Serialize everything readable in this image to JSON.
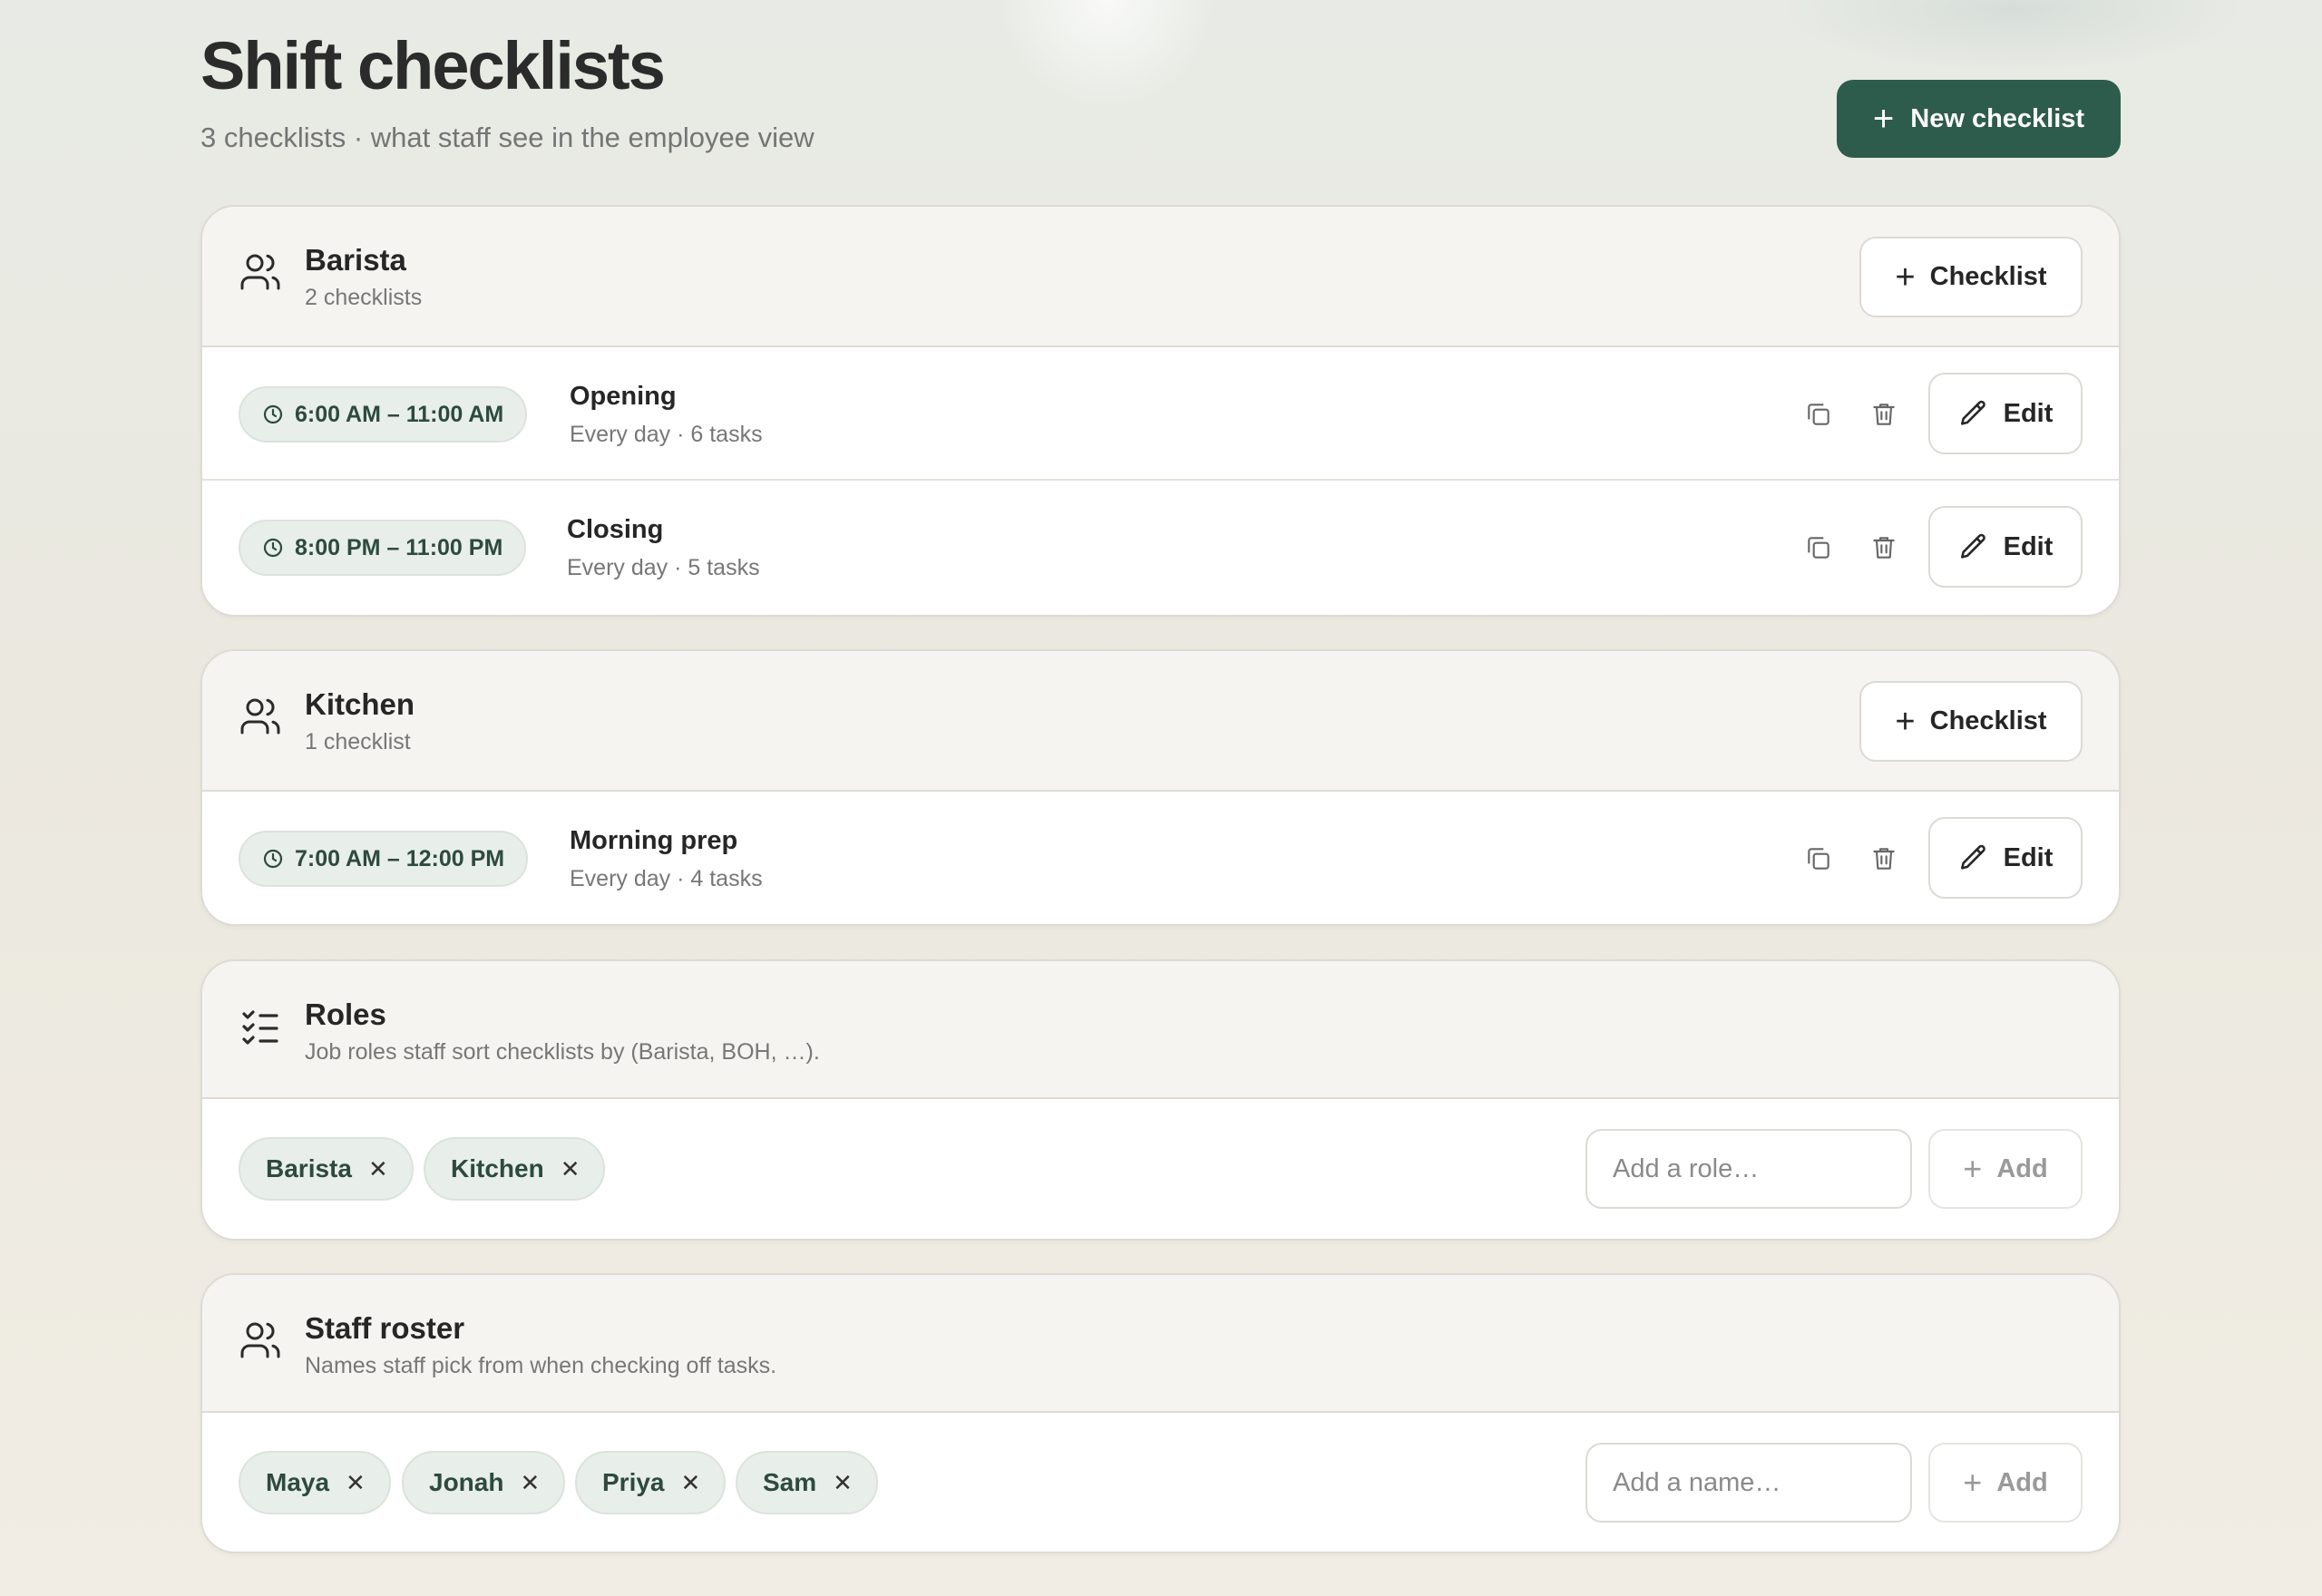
{
  "header": {
    "title": "Shift checklists",
    "subtitle": "3 checklists · what staff see in the employee view",
    "new_button_label": "New checklist"
  },
  "groups": [
    {
      "name": "Barista",
      "count_label": "2 checklists",
      "add_button_label": "Checklist",
      "checklists": [
        {
          "time": "6:00 AM – 11:00 AM",
          "title": "Opening",
          "meta": "Every day · 6 tasks",
          "edit_label": "Edit"
        },
        {
          "time": "8:00 PM – 11:00 PM",
          "title": "Closing",
          "meta": "Every day · 5 tasks",
          "edit_label": "Edit"
        }
      ]
    },
    {
      "name": "Kitchen",
      "count_label": "1 checklist",
      "add_button_label": "Checklist",
      "checklists": [
        {
          "time": "7:00 AM – 12:00 PM",
          "title": "Morning prep",
          "meta": "Every day · 4 tasks",
          "edit_label": "Edit"
        }
      ]
    }
  ],
  "roles": {
    "title": "Roles",
    "description": "Job roles staff sort checklists by (Barista, BOH, …).",
    "chips": [
      "Barista",
      "Kitchen"
    ],
    "input_placeholder": "Add a role…",
    "add_label": "Add"
  },
  "roster": {
    "title": "Staff roster",
    "description": "Names staff pick from when checking off tasks.",
    "chips": [
      "Maya",
      "Jonah",
      "Priya",
      "Sam"
    ],
    "input_placeholder": "Add a name…",
    "add_label": "Add"
  },
  "icons": {
    "group": "users-icon",
    "roles": "list-checks-icon",
    "time": "clock-icon",
    "duplicate": "copy-icon",
    "delete": "trash-icon",
    "edit": "pencil-icon",
    "add": "plus-icon",
    "remove": "close-icon"
  },
  "colors": {
    "primary": "#2e5c4c",
    "chip_bg": "#e8eee9",
    "chip_text": "#2d4a3f"
  }
}
